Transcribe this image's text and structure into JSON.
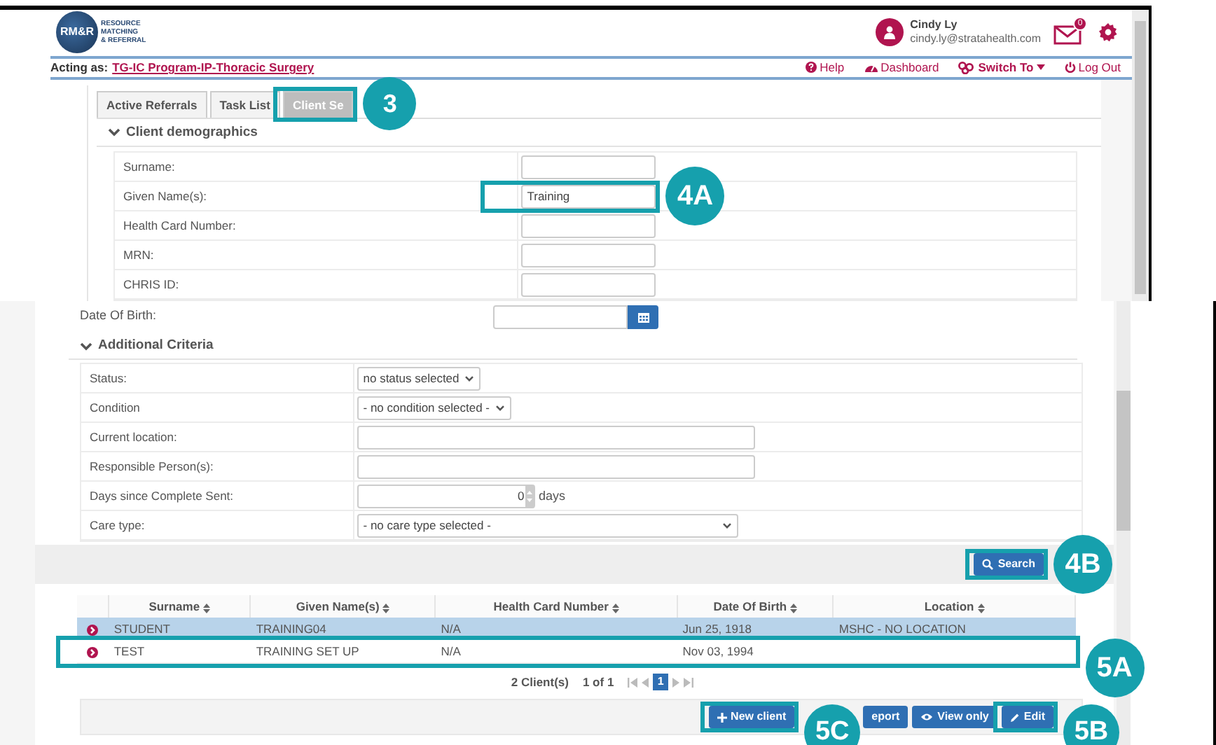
{
  "header": {
    "logo_mark": "RM&R",
    "logo_lines": [
      "RESOURCE",
      "MATCHING",
      "& REFERRAL"
    ],
    "user_name": "Cindy Ly",
    "user_email": "cindy.ly@stratahealth.com",
    "mail_count": "0"
  },
  "acting_as": {
    "label": "Acting as:",
    "program": "TG-IC Program-IP-Thoracic Surgery"
  },
  "nav_links": [
    {
      "kind": "help",
      "label": "Help",
      "has_menu": false
    },
    {
      "kind": "dashboard",
      "label": "Dashboard",
      "has_menu": false
    },
    {
      "kind": "switch",
      "label": "Switch To",
      "has_menu": true
    },
    {
      "kind": "logout",
      "label": "Log Out",
      "has_menu": false
    }
  ],
  "tabs": [
    {
      "label": "Active Referrals",
      "selected": false
    },
    {
      "label": "Task List",
      "selected": false
    },
    {
      "label": "Client Se",
      "selected": true
    }
  ],
  "demographics": {
    "title": "Client demographics",
    "expanded": true,
    "fields": [
      {
        "label": "Surname:"
      },
      {
        "label": "Given Name(s):",
        "value": "Training"
      },
      {
        "label": "Health Card Number:"
      },
      {
        "label": "MRN:"
      },
      {
        "label": "CHRIS ID:"
      }
    ]
  },
  "date_of_birth": {
    "label": "Date Of Birth:"
  },
  "additional": {
    "title": "Additional Criteria",
    "expanded": true,
    "fields": [
      {
        "kind": "select",
        "label": "Status:",
        "value": "no status selected"
      },
      {
        "kind": "select",
        "label": "Condition",
        "value": "- no condition selected -"
      },
      {
        "kind": "text",
        "label": "Current location:"
      },
      {
        "kind": "text",
        "label": "Responsible Person(s):"
      },
      {
        "kind": "number",
        "label": "Days since Complete Sent:",
        "value": "0",
        "unit": "days"
      },
      {
        "kind": "wide-select",
        "label": "Care type:",
        "value": "- no care type selected -"
      }
    ]
  },
  "search_button": {
    "label": "Search"
  },
  "results": {
    "columns": [
      "Surname",
      "Given Name(s)",
      "Health Card Number",
      "Date Of Birth",
      "Location"
    ],
    "rows": [
      {
        "selected": true,
        "cells": [
          "STUDENT",
          "TRAINING04",
          "N/A",
          "Jun 25, 1918",
          "MSHC - NO LOCATION"
        ]
      },
      {
        "selected": false,
        "cells": [
          "TEST",
          "TRAINING SET UP",
          "N/A",
          "Nov 03, 1994",
          ""
        ]
      }
    ]
  },
  "pagination": {
    "count": "2 Client(s)",
    "pages": "1 of 1",
    "current": "1"
  },
  "footer_buttons": [
    {
      "kind": "add",
      "label": "New client"
    },
    {
      "kind": "report",
      "label": "eport"
    },
    {
      "kind": "view",
      "label": "View only"
    },
    {
      "kind": "edit",
      "label": "Edit"
    }
  ],
  "callouts": [
    {
      "label": "3"
    },
    {
      "label": "4A"
    },
    {
      "label": "4B"
    },
    {
      "label": "5A"
    },
    {
      "label": "5B"
    },
    {
      "label": "5C"
    }
  ]
}
